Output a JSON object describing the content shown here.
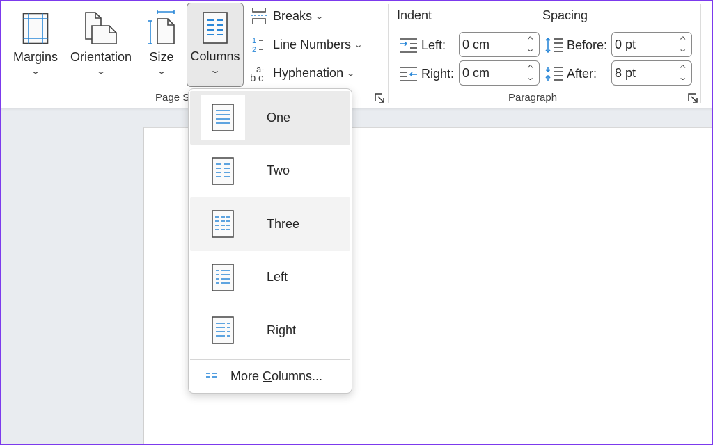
{
  "ribbon": {
    "page_setup": {
      "group_label": "Page Setup",
      "group_label_visible": "Page S",
      "margins": {
        "label": "Margins",
        "icon": "margins-icon"
      },
      "orientation": {
        "label": "Orientation",
        "icon": "orientation-icon"
      },
      "size": {
        "label": "Size",
        "icon": "size-icon"
      },
      "columns": {
        "label": "Columns",
        "icon": "columns-icon",
        "active": true
      },
      "breaks": {
        "label": "Breaks",
        "icon": "breaks-icon"
      },
      "line_numbers": {
        "label": "Line Numbers",
        "icon": "line-numbers-icon"
      },
      "hyphenation": {
        "label": "Hyphenation",
        "icon": "hyphenation-icon"
      }
    },
    "paragraph": {
      "group_label": "Paragraph",
      "indent": {
        "title": "Indent",
        "left_label": "Left:",
        "left_value": "0 cm",
        "right_label": "Right:",
        "right_value": "0 cm"
      },
      "spacing": {
        "title": "Spacing",
        "before_label": "Before:",
        "before_value": "0 pt",
        "after_label": "After:",
        "after_value": "8 pt"
      }
    }
  },
  "columns_menu": {
    "items": [
      {
        "label": "One",
        "icon": "one-column-icon",
        "selected": true
      },
      {
        "label": "Two",
        "icon": "two-columns-icon"
      },
      {
        "label": "Three",
        "icon": "three-columns-icon",
        "hovered": true
      },
      {
        "label": "Left",
        "icon": "left-column-icon"
      },
      {
        "label": "Right",
        "icon": "right-column-icon"
      }
    ],
    "more": {
      "prefix": "More ",
      "accel": "C",
      "suffix": "olumns...",
      "icon": "more-columns-icon"
    }
  },
  "colors": {
    "accent_blue": "#2b88d8",
    "frame": "#7c3aed"
  }
}
